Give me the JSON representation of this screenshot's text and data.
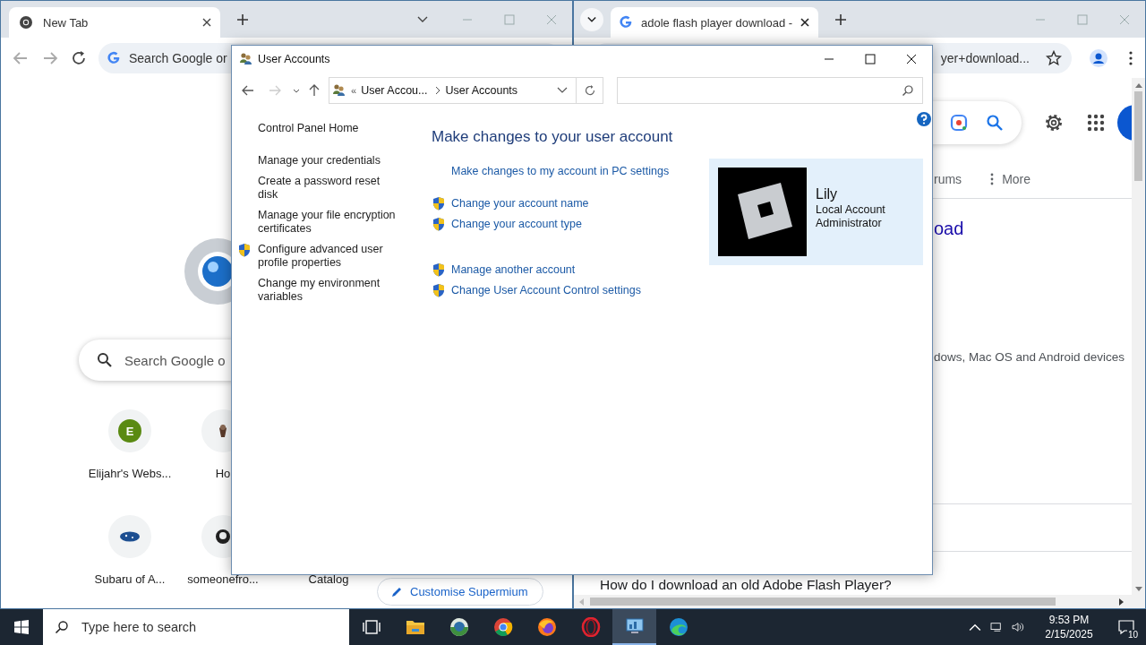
{
  "left_browser": {
    "tabs": [
      {
        "label": "New Tab",
        "selected": true
      }
    ],
    "address_placeholder": "Search Google or",
    "search_placeholder": "Search Google o",
    "shortcut_rows": [
      [
        {
          "label": "Elijahr's Webs...",
          "kind": "letter",
          "initial": "E"
        },
        {
          "label": "Ho"
        }
      ],
      [
        {
          "label": "Subaru of A...",
          "kind": "oval"
        },
        {
          "label": "someonefro...",
          "kind": "octocat"
        },
        {
          "label": "Catalog"
        }
      ]
    ],
    "customise_button": "Customise Supermium"
  },
  "right_browser": {
    "tabs": [
      {
        "label": "adole flash player download -",
        "selected": true
      }
    ],
    "address": "yer+download...",
    "nav_tabs": [
      {
        "label": "rums",
        "kind": "plain"
      },
      {
        "label": "More",
        "kind": "menu"
      }
    ],
    "result_title": "oad",
    "snippet": "dows, Mac OS and Android devices",
    "question": "How do I download an old Adobe Flash Player?"
  },
  "dialog": {
    "title": "User Accounts",
    "address": {
      "prefix": "«",
      "crumbs": [
        "User Accou...",
        "User Accounts"
      ]
    },
    "sidebar_groups": [
      [
        {
          "label": "Control Panel Home",
          "shield": false
        }
      ],
      [
        {
          "label": "Manage your credentials",
          "shield": false
        },
        {
          "label": "Create a password reset disk",
          "shield": false
        },
        {
          "label": "Manage your file encryption certificates",
          "shield": false
        },
        {
          "label": "Configure advanced user profile properties",
          "shield": true
        },
        {
          "label": "Change my environment variables",
          "shield": false
        }
      ]
    ],
    "heading": "Make changes to your user account",
    "task_groups": [
      [
        {
          "label": "Make changes to my account in PC settings",
          "shield": false
        }
      ],
      [
        {
          "label": "Change your account name",
          "shield": true
        },
        {
          "label": "Change your account type",
          "shield": true
        }
      ],
      [
        {
          "label": "Manage another account",
          "shield": true
        },
        {
          "label": "Change User Account Control settings",
          "shield": true
        }
      ]
    ],
    "account": {
      "name": "Lily",
      "type": "Local Account",
      "role": "Administrator"
    }
  },
  "taskbar": {
    "search_placeholder": "Type here to search",
    "apps": [
      {
        "kind": "task-view",
        "selected": false
      },
      {
        "kind": "folder",
        "selected": false
      },
      {
        "kind": "globe",
        "selected": false
      },
      {
        "kind": "chrome",
        "selected": false
      },
      {
        "kind": "firefox",
        "selected": false
      },
      {
        "kind": "opera",
        "selected": false
      },
      {
        "kind": "control-panel",
        "selected": true
      },
      {
        "kind": "edge",
        "selected": false
      }
    ],
    "time": "9:53 PM",
    "date": "2/15/2025",
    "notifications": "10"
  }
}
